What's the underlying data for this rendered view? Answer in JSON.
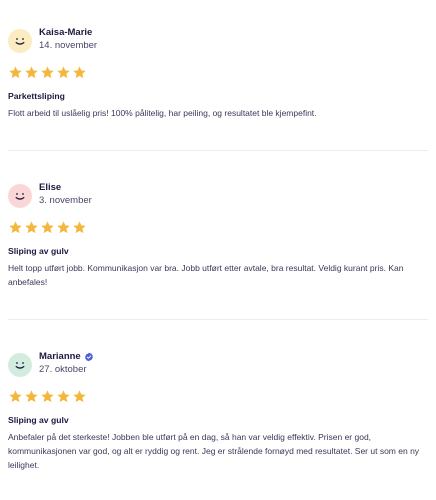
{
  "reviews": [
    {
      "name": "Kaisa-Marie",
      "date": "14. november",
      "verified": false,
      "avatar_color": "#fbecc1",
      "rating": 5,
      "title": "Parkettsliping",
      "text": "Flott arbeid til uslåelig pris! 100% pålitelig, har peiling, og resultatet ble kjempefint."
    },
    {
      "name": "Elise",
      "date": "3. november",
      "verified": false,
      "avatar_color": "#fbd6d6",
      "rating": 5,
      "title": "Sliping av gulv",
      "text": "Helt topp utført jobb. Kommunikasjon var bra. Jobb utført etter avtale, bra resultat. Veldig kurant pris. Kan anbefales!"
    },
    {
      "name": "Marianne",
      "date": "27. oktober",
      "verified": true,
      "avatar_color": "#d3ece0",
      "rating": 5,
      "title": "Sliping av gulv",
      "text": "Anbefaler på det sterkeste! Jobben ble utført på en dag, så han var veldig effektiv. Prisen er god, kommunikasjonen var god, og alt er ryddig og rent. Jeg er strålende fornøyd med resultatet. Ser ut som en ny leilighet."
    }
  ],
  "colors": {
    "star": "#f3b73c",
    "verified_badge": "#4b5fd6",
    "text_primary": "#1d1a40"
  },
  "icons": {
    "avatar": "smiley-face-icon",
    "star": "star-icon",
    "verified": "verified-badge-icon"
  }
}
